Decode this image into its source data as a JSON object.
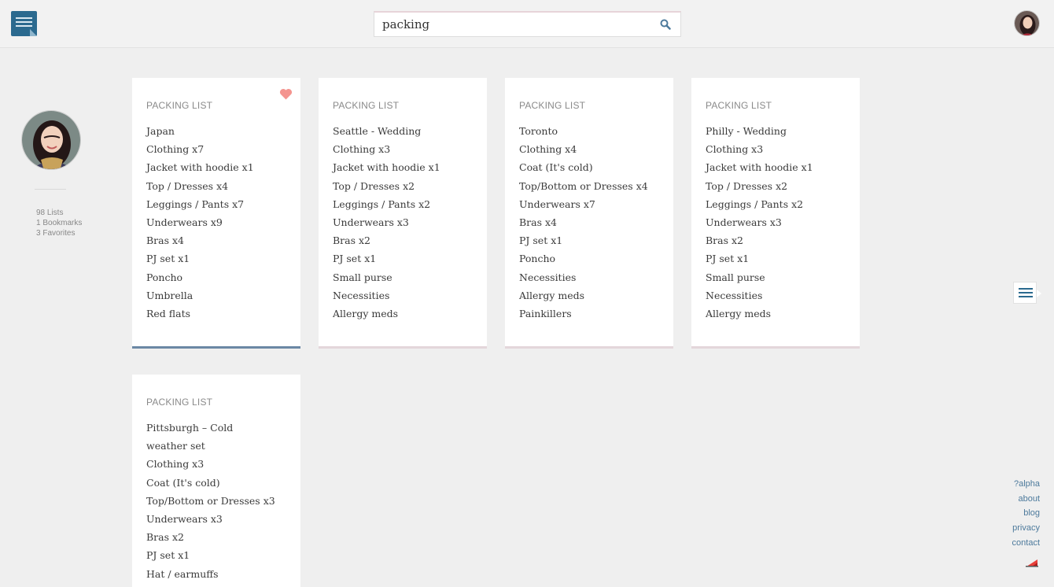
{
  "header": {
    "menu_icon": "menu-icon",
    "search": {
      "value": "packing",
      "icon": "search-icon"
    },
    "avatar_icon": "user-avatar"
  },
  "profile": {
    "avatar_icon": "profile-avatar",
    "stats": [
      "98 Lists",
      "1 Bookmarks",
      "3 Favorites"
    ]
  },
  "cards": [
    {
      "title": "PACKING LIST",
      "favorited": true,
      "items": [
        "Japan",
        "Clothing x7",
        "Jacket with hoodie x1",
        "Top / Dresses x4",
        "Leggings / Pants x7",
        "Underwears x9",
        "Bras x4",
        "PJ set x1",
        "Poncho",
        "Umbrella",
        "Red flats"
      ]
    },
    {
      "title": "PACKING LIST",
      "favorited": false,
      "items": [
        "Seattle - Wedding",
        "Clothing x3",
        "Jacket with hoodie x1",
        "Top / Dresses x2",
        "Leggings / Pants x2",
        "Underwears x3",
        "Bras x2",
        "PJ set x1",
        "Small purse",
        "Necessities",
        "Allergy meds"
      ]
    },
    {
      "title": "PACKING LIST",
      "favorited": false,
      "items": [
        "Toronto",
        "Clothing x4",
        "Coat (It's cold)",
        "Top/Bottom or Dresses x4",
        "Underwears x7",
        "Bras x4",
        "PJ set x1",
        "Poncho",
        "Necessities",
        "Allergy meds",
        "Painkillers"
      ]
    },
    {
      "title": "PACKING LIST",
      "favorited": false,
      "items": [
        "Philly - Wedding",
        "Clothing x3",
        "Jacket with hoodie x1",
        "Top / Dresses x2",
        "Leggings / Pants x2",
        "Underwears x3",
        "Bras x2",
        "PJ set x1",
        "Small purse",
        "Necessities",
        "Allergy meds"
      ]
    },
    {
      "title": "PACKING LIST",
      "favorited": false,
      "items": [
        "Pittsburgh – Cold weather set",
        "Clothing x3",
        "Coat (It's cold)",
        "Top/Bottom or Dresses x3",
        "Underwears x3",
        "Bras x2",
        "PJ set x1",
        "Hat / earmuffs"
      ]
    }
  ],
  "footer": {
    "links": [
      "?alpha",
      "about",
      "blog",
      "privacy",
      "contact"
    ]
  },
  "colors": {
    "brand": "#2b6a8f",
    "heart": "#f4948f",
    "active_card_border": "#6b88a4",
    "link": "#4d7a9c"
  }
}
